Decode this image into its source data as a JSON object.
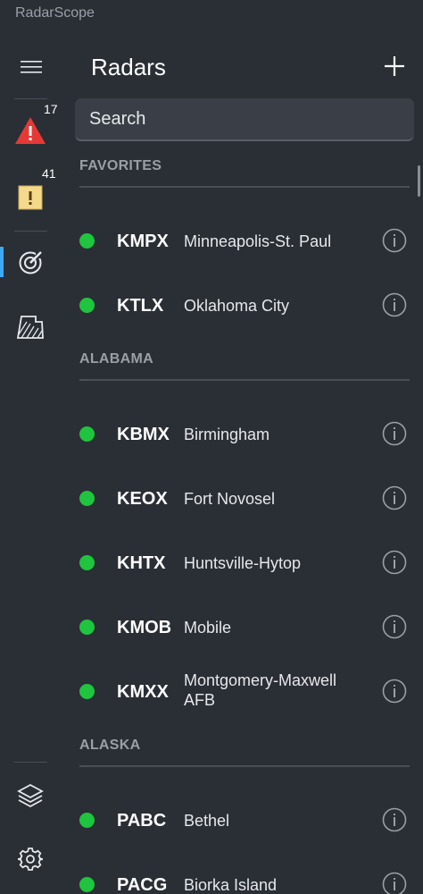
{
  "app": {
    "title": "RadarScope"
  },
  "rail": {
    "warnings_count": "17",
    "watches_count": "41"
  },
  "header": {
    "title": "Radars"
  },
  "search": {
    "placeholder": "Search"
  },
  "sections": [
    {
      "title": "FAVORITES",
      "items": [
        {
          "code": "KMPX",
          "name": "Minneapolis-St. Paul"
        },
        {
          "code": "KTLX",
          "name": "Oklahoma City"
        }
      ]
    },
    {
      "title": "ALABAMA",
      "items": [
        {
          "code": "KBMX",
          "name": "Birmingham"
        },
        {
          "code": "KEOX",
          "name": "Fort Novosel"
        },
        {
          "code": "KHTX",
          "name": "Huntsville-Hytop"
        },
        {
          "code": "KMOB",
          "name": "Mobile"
        },
        {
          "code": "KMXX",
          "name": "Montgomery-Maxwell AFB"
        }
      ]
    },
    {
      "title": "ALASKA",
      "items": [
        {
          "code": "PABC",
          "name": "Bethel"
        },
        {
          "code": "PACG",
          "name": "Biorka Island"
        }
      ]
    }
  ],
  "colors": {
    "background": "#2a2e35",
    "status_online": "#1fc43f",
    "warning_red": "#e53935",
    "watch_yellow": "#f5d98a",
    "active_accent": "#3ea8f5"
  },
  "icons": {
    "menu": "hamburger-icon",
    "warnings": "warning-triangle-icon",
    "watches": "watch-square-icon",
    "radars": "radar-icon",
    "map": "map-region-icon",
    "layers": "layers-icon",
    "settings": "gear-icon",
    "add": "plus-icon",
    "info": "info-icon"
  }
}
